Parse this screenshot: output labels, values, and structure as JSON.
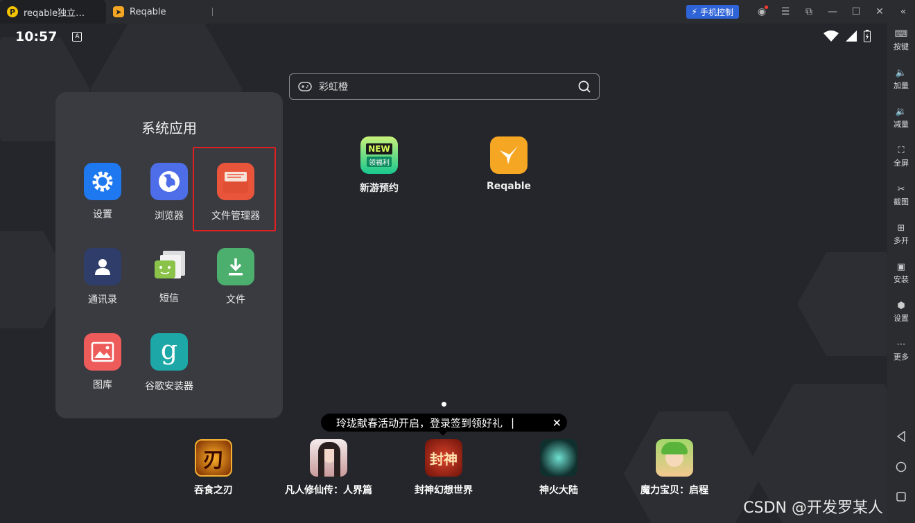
{
  "tabs": [
    {
      "label": "reqable独立…"
    },
    {
      "label": "Reqable"
    }
  ],
  "window": {
    "phone_control": "手机控制"
  },
  "status": {
    "time": "10:57"
  },
  "search": {
    "text": "彩虹橙"
  },
  "folder": {
    "title": "系统应用",
    "apps": [
      {
        "label": "设置",
        "color": "#1e78f0"
      },
      {
        "label": "浏览器",
        "color": "#4d6ee8"
      },
      {
        "label": "文件管理器",
        "color": "#e8553a"
      },
      {
        "label": "通讯录",
        "color": "#2f3d6b"
      },
      {
        "label": "短信",
        "color": "#8bc34a"
      },
      {
        "label": "文件",
        "color": "#4caf6e"
      },
      {
        "label": "图库",
        "color": "#ee5b5b"
      },
      {
        "label": "谷歌安装器",
        "color": "#1ea7a7"
      }
    ]
  },
  "desktop": {
    "apps": [
      {
        "label": "新游预约",
        "badge_top": "NEW",
        "badge_bottom": "领福利"
      },
      {
        "label": "Reqable"
      }
    ]
  },
  "banner": {
    "text": "玲珑献春活动开启，登录签到领好礼",
    "close": "✕"
  },
  "dock": [
    {
      "label": "吞食之刃",
      "glyph": "刃"
    },
    {
      "label": "凡人修仙传：人界篇",
      "glyph": ""
    },
    {
      "label": "封神幻想世界",
      "glyph": "封神"
    },
    {
      "label": "神火大陆",
      "glyph": ""
    },
    {
      "label": "魔力宝贝：启程",
      "glyph": ""
    }
  ],
  "sidebar": [
    {
      "label": "按键",
      "icon": "keyboard-icon"
    },
    {
      "label": "加量",
      "icon": "volume-up-icon"
    },
    {
      "label": "减量",
      "icon": "volume-down-icon"
    },
    {
      "label": "全屏",
      "icon": "fullscreen-icon"
    },
    {
      "label": "截图",
      "icon": "scissors-icon"
    },
    {
      "label": "多开",
      "icon": "multi-instance-icon"
    },
    {
      "label": "安装",
      "icon": "apk-install-icon"
    },
    {
      "label": "设置",
      "icon": "settings-icon"
    },
    {
      "label": "更多",
      "icon": "more-icon"
    }
  ],
  "watermark": "CSDN @开发罗某人"
}
